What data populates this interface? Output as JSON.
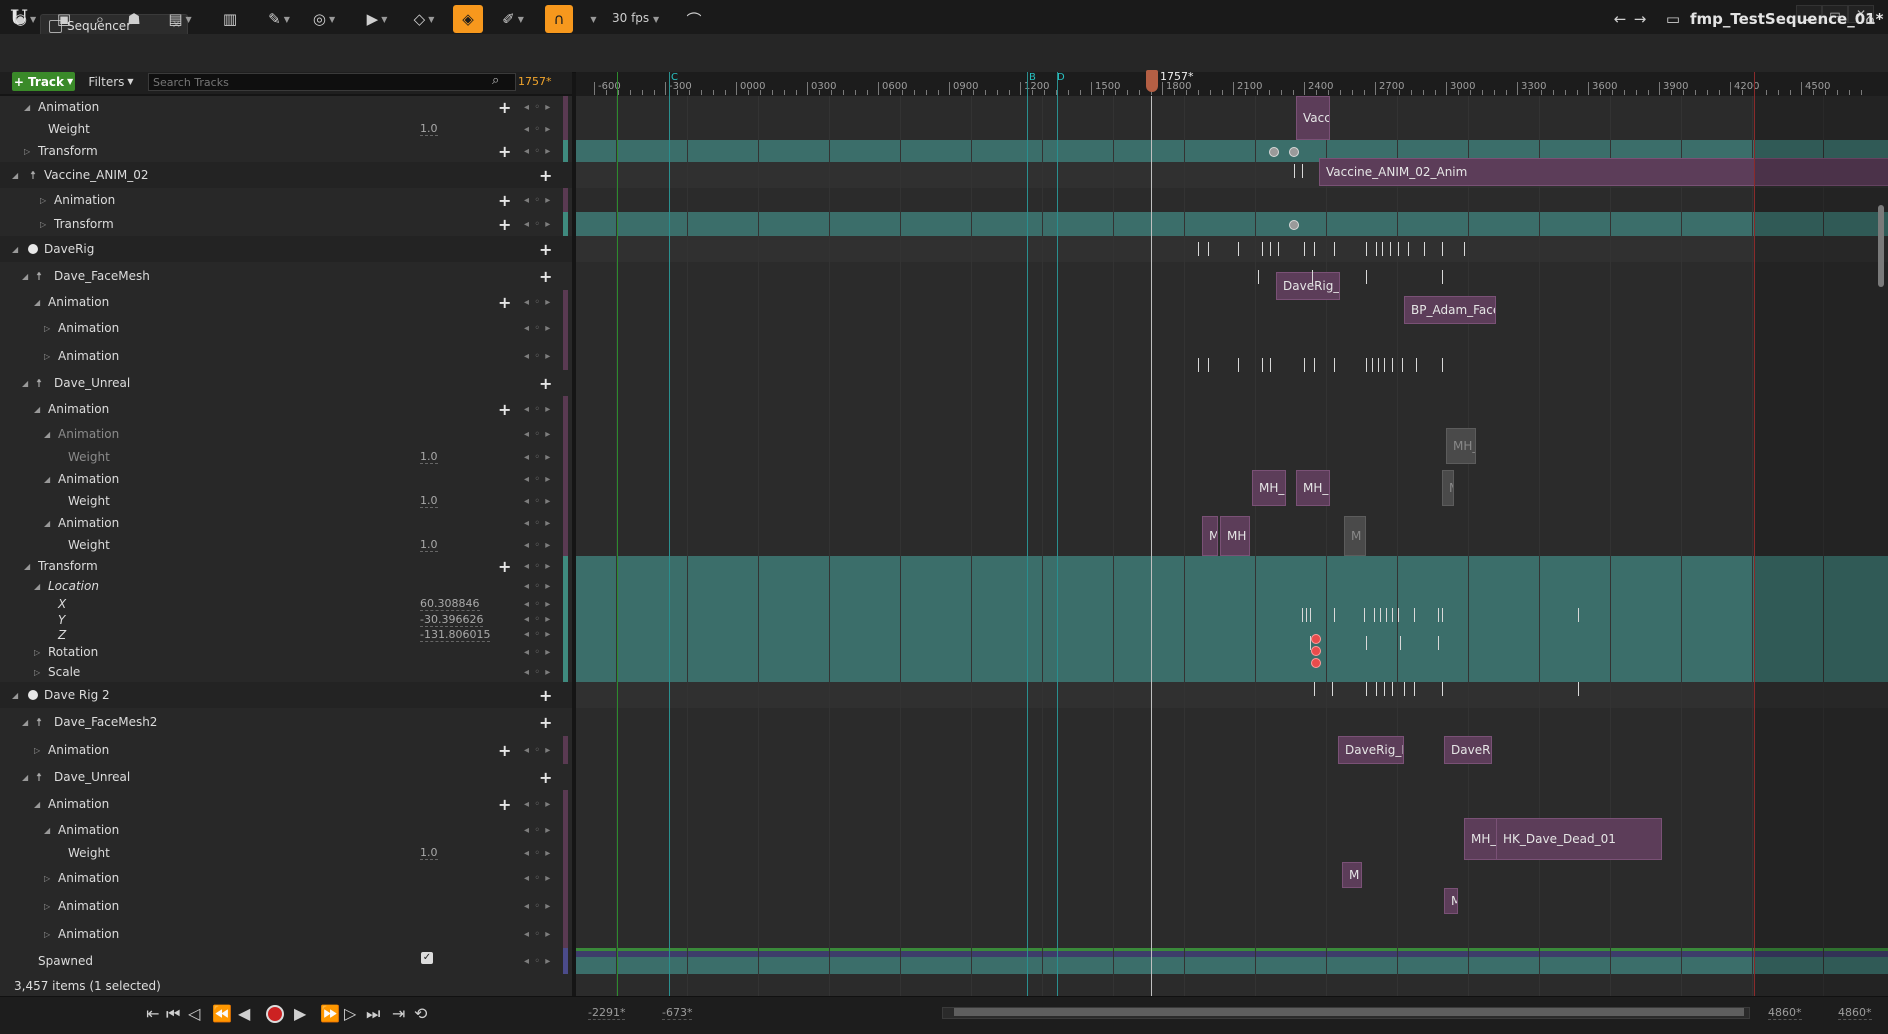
{
  "window": {
    "tab_title": "Sequencer",
    "sequence_name": "fmp_TestSequence_01*",
    "buttons": {
      "minimize": "▁",
      "maximize": "▭",
      "close": "✕"
    }
  },
  "toolbar": {
    "fps": "30 fps",
    "icons": [
      "camera-icon",
      "save-icon",
      "find-icon",
      "actor-icon",
      "clapper-icon",
      "render-icon",
      "tools-icon",
      "visibility-icon",
      "play-icon",
      "key-icon",
      "auto-key-icon",
      "edit-icon",
      "snap-magnet-icon",
      "curve-editor-icon"
    ]
  },
  "trackbar": {
    "track_label": "+ Track",
    "filters_label": "Filters",
    "search_placeholder": "Search Tracks",
    "current_time": "1757*"
  },
  "ruler": {
    "ticks": [
      "-600",
      "-300",
      "0000",
      "0300",
      "0600",
      "0900",
      "1200",
      "1500",
      "1800",
      "2100",
      "2400",
      "2700",
      "3000",
      "3300",
      "3600",
      "3900",
      "4200",
      "4500"
    ],
    "markers": [
      "C",
      "B",
      "D"
    ],
    "playhead_label": "1757*"
  },
  "outliner": {
    "rows": [
      {
        "label": "Animation",
        "value": "",
        "kind": "sub"
      },
      {
        "label": "Weight",
        "value": "1.0",
        "kind": "prop"
      },
      {
        "label": "Transform",
        "value": "",
        "kind": "sub"
      },
      {
        "label": "Vaccine_ANIM_02",
        "value": "",
        "kind": "header"
      },
      {
        "label": "Animation",
        "value": "",
        "kind": "sub"
      },
      {
        "label": "Transform",
        "value": "",
        "kind": "sub"
      },
      {
        "label": "DaveRig",
        "value": "",
        "kind": "header"
      },
      {
        "label": "Dave_FaceMesh",
        "value": "",
        "kind": "component"
      },
      {
        "label": "Animation",
        "value": "",
        "kind": "sub"
      },
      {
        "label": "Animation",
        "value": "",
        "kind": "sub"
      },
      {
        "label": "Animation",
        "value": "",
        "kind": "sub"
      },
      {
        "label": "Dave_Unreal",
        "value": "",
        "kind": "component"
      },
      {
        "label": "Animation",
        "value": "",
        "kind": "sub"
      },
      {
        "label": "Animation",
        "value": "",
        "kind": "sub"
      },
      {
        "label": "Weight",
        "value": "1.0",
        "kind": "prop"
      },
      {
        "label": "Animation",
        "value": "",
        "kind": "sub"
      },
      {
        "label": "Weight",
        "value": "1.0",
        "kind": "prop"
      },
      {
        "label": "Animation",
        "value": "",
        "kind": "sub"
      },
      {
        "label": "Weight",
        "value": "1.0",
        "kind": "prop"
      },
      {
        "label": "Transform",
        "value": "",
        "kind": "sub"
      },
      {
        "label": "Location",
        "value": "",
        "kind": "sub"
      },
      {
        "label": "X",
        "value": "60.308846",
        "kind": "prop"
      },
      {
        "label": "Y",
        "value": "-30.396626",
        "kind": "prop"
      },
      {
        "label": "Z",
        "value": "-131.806015",
        "kind": "prop"
      },
      {
        "label": "Rotation",
        "value": "",
        "kind": "sub"
      },
      {
        "label": "Scale",
        "value": "",
        "kind": "sub"
      },
      {
        "label": "Dave Rig 2",
        "value": "",
        "kind": "header"
      },
      {
        "label": "Dave_FaceMesh2",
        "value": "",
        "kind": "component"
      },
      {
        "label": "Animation",
        "value": "",
        "kind": "sub"
      },
      {
        "label": "Dave_Unreal",
        "value": "",
        "kind": "component"
      },
      {
        "label": "Animation",
        "value": "",
        "kind": "sub"
      },
      {
        "label": "Animation",
        "value": "",
        "kind": "sub"
      },
      {
        "label": "Weight",
        "value": "1.0",
        "kind": "prop"
      },
      {
        "label": "Animation",
        "value": "",
        "kind": "sub"
      },
      {
        "label": "Animation",
        "value": "",
        "kind": "sub"
      },
      {
        "label": "Animation",
        "value": "",
        "kind": "sub"
      },
      {
        "label": "Spawned",
        "value": "",
        "kind": "prop"
      }
    ],
    "status": "3,457 items (1 selected)"
  },
  "sections": [
    {
      "label": "Vacc"
    },
    {
      "label": "Vaccine_ANIM_02_Anim"
    },
    {
      "label": "DaveRig_F"
    },
    {
      "label": "BP_Adam_Face"
    },
    {
      "label": "MH_"
    },
    {
      "label": "MH_"
    },
    {
      "label": "MH_I"
    },
    {
      "label": "M"
    },
    {
      "label": "M"
    },
    {
      "label": "MH"
    },
    {
      "label": "M"
    },
    {
      "label": "DaveRig_F"
    },
    {
      "label": "DaveR"
    },
    {
      "label": "MH_"
    },
    {
      "label": "HK_Dave_Dead_01"
    },
    {
      "label": "M"
    },
    {
      "label": "M"
    }
  ],
  "bottombar": {
    "view_start": "-2291*",
    "playback_start": "-673*",
    "playback_end": "4860*",
    "view_end": "4860*"
  },
  "colors": {
    "accent_orange": "#f7981d",
    "track_green": "#3a8a29",
    "section_purple": "#5c3d59",
    "transform_teal": "#3b6e6a",
    "marker_cyan": "#2a8f8f"
  }
}
